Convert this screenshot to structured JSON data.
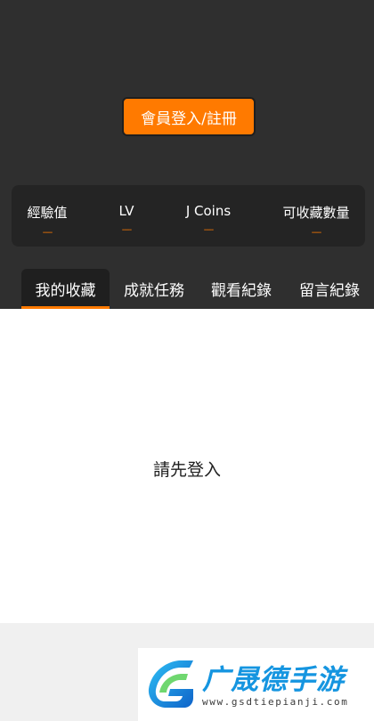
{
  "header": {
    "login_button_label": "會員登入/註冊"
  },
  "stats": [
    {
      "label": "經驗值",
      "value": "----"
    },
    {
      "label": "LV",
      "value": "----"
    },
    {
      "label": "J Coins",
      "value": "----"
    },
    {
      "label": "可收藏數量",
      "value": "----"
    }
  ],
  "tabs": [
    {
      "label": "我的收藏",
      "active": true
    },
    {
      "label": "成就任務",
      "active": false
    },
    {
      "label": "觀看紀錄",
      "active": false
    },
    {
      "label": "留言紀錄",
      "active": false
    }
  ],
  "content": {
    "empty_message": "請先登入"
  },
  "watermark": {
    "title": "广晟德手游",
    "url": "www.gsdtiepianji.com"
  },
  "colors": {
    "accent": "#ff7a00",
    "header_bg": "#2f2f2f",
    "watermark_blue": "#1595e0"
  }
}
